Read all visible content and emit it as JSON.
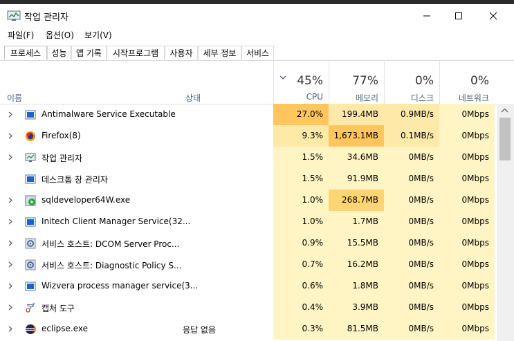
{
  "window": {
    "title": "작업 관리자",
    "controls": {
      "minimize": "—",
      "maximize": "☐",
      "close": "✕"
    },
    "background_url_fragment": "https://tzuyo.blog.fc2.co"
  },
  "menu": [
    "파일(F)",
    "옵션(O)",
    "보기(V)"
  ],
  "tabs": [
    "프로세스",
    "성능",
    "앱 기록",
    "시작프로그램",
    "사용자",
    "세부 정보",
    "서비스"
  ],
  "active_tab": "프로세스",
  "columns": {
    "name": "이름",
    "status": "상태",
    "cpu": {
      "pct": "45%",
      "label": "CPU"
    },
    "memory": {
      "pct": "77%",
      "label": "메모리"
    },
    "disk": {
      "pct": "0%",
      "label": "디스크"
    },
    "network": {
      "pct": "0%",
      "label": "네트워크"
    }
  },
  "colors": {
    "heat_light": "#fff4c4",
    "heat_mid": "#ffe9a8",
    "heat_strong": "#ffd472",
    "heat_hot": "#ffc65e",
    "header_label": "#4c607a",
    "scrollbar": "#c2c2c2"
  },
  "processes": [
    {
      "name": "Antimalware Service Executable",
      "icon": "shield-app-icon",
      "status": "",
      "cpu": "27.0%",
      "memory": "199.4MB",
      "disk": "0.9MB/s",
      "network": "0Mbps",
      "expandable": true
    },
    {
      "name": "Firefox(8)",
      "icon": "firefox-icon",
      "status": "",
      "cpu": "9.3%",
      "memory": "1,673.1MB",
      "disk": "0.1MB/s",
      "network": "0Mbps",
      "expandable": true
    },
    {
      "name": "작업 관리자",
      "icon": "task-manager-icon",
      "status": "",
      "cpu": "1.5%",
      "memory": "34.6MB",
      "disk": "0MB/s",
      "network": "0Mbps",
      "expandable": true
    },
    {
      "name": "데스크톱 창 관리자",
      "icon": "window-app-icon",
      "status": "",
      "cpu": "1.5%",
      "memory": "91.9MB",
      "disk": "0MB/s",
      "network": "0Mbps",
      "expandable": false
    },
    {
      "name": "sqldeveloper64W.exe",
      "icon": "sqldeveloper-icon",
      "status": "",
      "cpu": "1.0%",
      "memory": "268.7MB",
      "disk": "0MB/s",
      "network": "0Mbps",
      "expandable": true
    },
    {
      "name": "Initech Client Manager Service(32...",
      "icon": "window-app-icon",
      "status": "",
      "cpu": "1.0%",
      "memory": "1.7MB",
      "disk": "0MB/s",
      "network": "0Mbps",
      "expandable": true
    },
    {
      "name": "서비스 호스트: DCOM Server Proc...",
      "icon": "gear-service-icon",
      "status": "",
      "cpu": "0.9%",
      "memory": "15.5MB",
      "disk": "0MB/s",
      "network": "0Mbps",
      "expandable": true
    },
    {
      "name": "서비스 호스트: Diagnostic Policy S...",
      "icon": "gear-service-icon",
      "status": "",
      "cpu": "0.7%",
      "memory": "16.2MB",
      "disk": "0MB/s",
      "network": "0Mbps",
      "expandable": true
    },
    {
      "name": "Wizvera process manager service(3...",
      "icon": "window-app-icon",
      "status": "",
      "cpu": "0.6%",
      "memory": "1.8MB",
      "disk": "0MB/s",
      "network": "0Mbps",
      "expandable": true
    },
    {
      "name": "캡처 도구",
      "icon": "scissors-icon",
      "status": "",
      "cpu": "0.4%",
      "memory": "3.9MB",
      "disk": "0MB/s",
      "network": "0Mbps",
      "expandable": true
    },
    {
      "name": "eclipse.exe",
      "icon": "eclipse-icon",
      "status": "응답 없음",
      "cpu": "0.3%",
      "memory": "81.5MB",
      "disk": "0MB/s",
      "network": "0Mbps",
      "expandable": true
    }
  ]
}
